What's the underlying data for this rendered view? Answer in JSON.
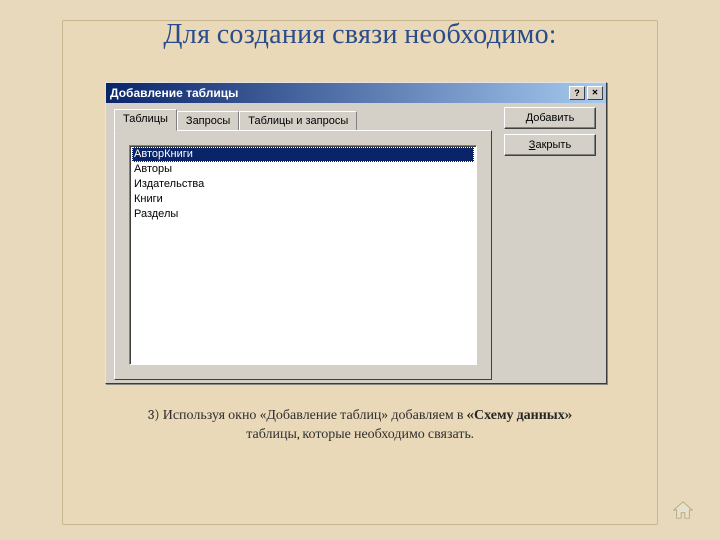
{
  "page": {
    "heading": "Для создания связи необходимо:",
    "caption_prefix": "3) Используя окно «Добавление таблиц» добавляем в ",
    "caption_bold": "«Схему данных»",
    "caption_line2": "таблицы, которые необходимо связать."
  },
  "dialog": {
    "title": "Добавление таблицы",
    "help_glyph": "?",
    "close_glyph": "✕",
    "tabs": {
      "t0": "Таблицы",
      "t1": "Запросы",
      "t2": "Таблицы и запросы"
    },
    "list": {
      "i0": "АвторКниги",
      "i1": "Авторы",
      "i2": "Издательства",
      "i3": "Книги",
      "i4": "Разделы"
    },
    "buttons": {
      "add_pre": "Д",
      "add_rest": "обавить",
      "close_pre": "З",
      "close_rest": "акрыть"
    }
  }
}
